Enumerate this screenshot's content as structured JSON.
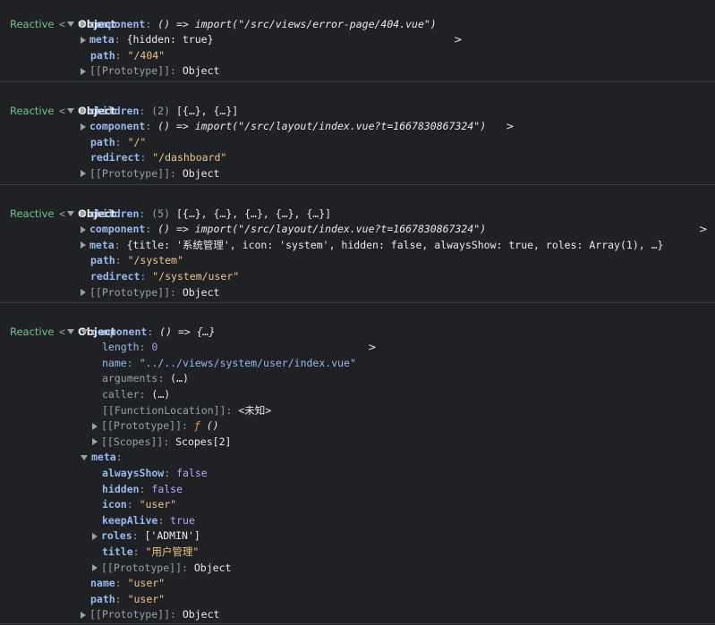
{
  "groups": [
    {
      "label": "Reactive",
      "prefix": "<",
      "object": "Object",
      "lines": [
        {
          "key": "component",
          "value": "() => import(\"/src/views/error-page/404.vue\")"
        },
        {
          "key": "meta",
          "value": "{hidden: true}"
        },
        {
          "key": "path",
          "value": "\"/404\""
        },
        {
          "key": "[[Prototype]]",
          "value": "Object"
        }
      ]
    },
    {
      "label": "Reactive",
      "prefix": "<",
      "object": "Object",
      "lines": [
        {
          "key": "children",
          "count": "(2)",
          "value": "[{…}, {…}]"
        },
        {
          "key": "component",
          "value": "() => import(\"/src/layout/index.vue?t=1667830867324\")"
        },
        {
          "key": "path",
          "value": "\"/\""
        },
        {
          "key": "redirect",
          "value": "\"/dashboard\""
        },
        {
          "key": "[[Prototype]]",
          "value": "Object"
        }
      ]
    },
    {
      "label": "Reactive",
      "prefix": "<",
      "object": "Object",
      "lines": [
        {
          "key": "children",
          "count": "(5)",
          "value": "[{…}, {…}, {…}, {…}, {…}]"
        },
        {
          "key": "component",
          "value": "() => import(\"/src/layout/index.vue?t=1667830867324\")"
        },
        {
          "key": "meta",
          "value": "{title: '系统管理', icon: 'system', hidden: false, alwaysShow: true, roles: Array(1), …}"
        },
        {
          "key": "path",
          "value": "\"/system\""
        },
        {
          "key": "redirect",
          "value": "\"/system/user\""
        },
        {
          "key": "[[Prototype]]",
          "value": "Object"
        }
      ]
    },
    {
      "label": "Reactive",
      "prefix": "<",
      "object": "Object",
      "component_key": "component",
      "component_value": "() => {…}",
      "component_props": [
        {
          "key": "length",
          "value": "0"
        },
        {
          "key": "name",
          "value": "\"../../views/system/user/index.vue\""
        },
        {
          "key": "arguments",
          "value": "(…)"
        },
        {
          "key": "caller",
          "value": "(…)"
        },
        {
          "key": "[[FunctionLocation]]",
          "value": "<未知>"
        },
        {
          "key": "[[Prototype]]",
          "f": "ƒ",
          "value": "()"
        },
        {
          "key": "[[Scopes]]",
          "value": "Scopes[2]"
        }
      ],
      "meta_key": "meta",
      "meta_props": [
        {
          "key": "alwaysShow",
          "value": "false"
        },
        {
          "key": "hidden",
          "value": "false"
        },
        {
          "key": "icon",
          "value": "\"user\""
        },
        {
          "key": "keepAlive",
          "value": "true"
        },
        {
          "key": "roles",
          "value": "['ADMIN']"
        },
        {
          "key": "title",
          "value": "\"用户管理\""
        },
        {
          "key": "[[Prototype]]",
          "value": "Object"
        }
      ],
      "tail": [
        {
          "key": "name",
          "value": "\"user\""
        },
        {
          "key": "path",
          "value": "\"user\""
        },
        {
          "key": "[[Prototype]]",
          "value": "Object"
        }
      ]
    }
  ],
  "chevron": ">"
}
